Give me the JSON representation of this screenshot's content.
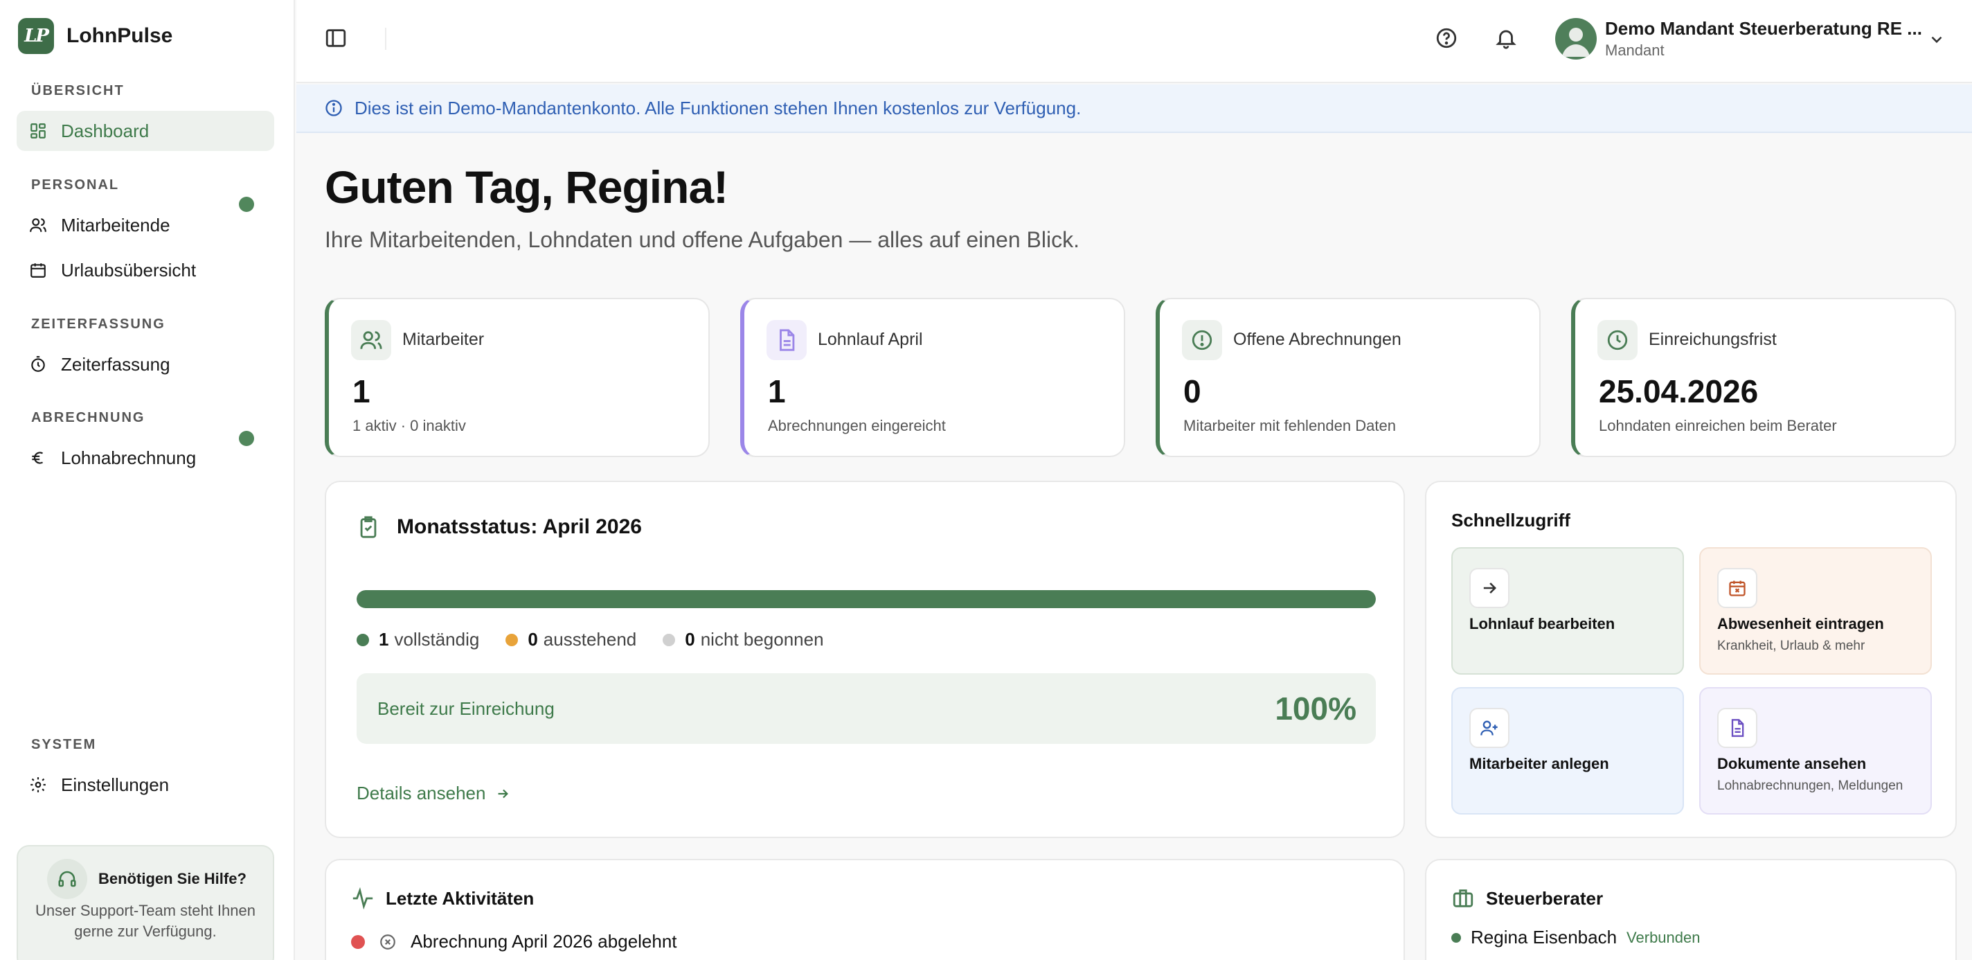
{
  "brand": {
    "logo_text": "LP",
    "name": "LohnPulse"
  },
  "sidebar": {
    "sections": [
      {
        "label": "ÜBERSICHT",
        "items": [
          {
            "label": "Dashboard",
            "icon": "dashboard-icon",
            "active": true
          }
        ]
      },
      {
        "label": "PERSONAL",
        "items": [
          {
            "label": "Mitarbeitende",
            "icon": "users-icon"
          },
          {
            "label": "Urlaubsübersicht",
            "icon": "calendar-icon"
          }
        ]
      },
      {
        "label": "ZEITERFASSUNG",
        "items": [
          {
            "label": "Zeiterfassung",
            "icon": "timer-icon"
          }
        ]
      },
      {
        "label": "ABRECHNUNG",
        "items": [
          {
            "label": "Lohnabrechnung",
            "icon": "euro-icon"
          }
        ]
      },
      {
        "label": "SYSTEM",
        "items": [
          {
            "label": "Einstellungen",
            "icon": "gear-icon"
          }
        ]
      }
    ],
    "help": {
      "title": "Benötigen Sie Hilfe?",
      "text": "Unser Support-Team steht Ihnen gerne zur Verfügung."
    }
  },
  "topbar": {
    "user_name": "Demo Mandant Steuerberatung RE ...",
    "user_role": "Mandant"
  },
  "banner": {
    "text": "Dies ist ein Demo-Mandantenkonto. Alle Funktionen stehen Ihnen kostenlos zur Verfügung."
  },
  "greeting": {
    "title": "Guten Tag, Regina!",
    "subtitle": "Ihre Mitarbeitenden, Lohndaten und offene Aufgaben — alles auf einen Blick."
  },
  "stats": [
    {
      "label": "Mitarbeiter",
      "value": "1",
      "sub": "1 aktiv · 0 inaktiv"
    },
    {
      "label": "Lohnlauf April",
      "value": "1",
      "sub": "Abrechnungen eingereicht"
    },
    {
      "label": "Offene Abrechnungen",
      "value": "0",
      "sub": "Mitarbeiter mit fehlenden Daten"
    },
    {
      "label": "Einreichungsfrist",
      "value": "25.04.2026",
      "sub": "Lohndaten einreichen beim Berater"
    }
  ],
  "month_status": {
    "title": "Monatsstatus: April 2026",
    "progress_fraction": 1.0,
    "legend": [
      {
        "count": "1",
        "label": "vollständig",
        "color": "#4a7d55"
      },
      {
        "count": "0",
        "label": "ausstehend",
        "color": "#e8a33a"
      },
      {
        "count": "0",
        "label": "nicht begonnen",
        "color": "#d0d0d0"
      }
    ],
    "ready_label": "Bereit zur Einreichung",
    "ready_percent": "100%",
    "details_link": "Details ansehen"
  },
  "quick_access": {
    "title": "Schnellzugriff",
    "tiles": [
      {
        "title": "Lohnlauf bearbeiten",
        "sub": "",
        "icon": "arrow-right-icon",
        "bg": "#eef3ee",
        "border": "#d5e1d5",
        "icon_color": "#333333"
      },
      {
        "title": "Abwesenheit eintragen",
        "sub": "Krankheit, Urlaub & mehr",
        "icon": "calendar-x-icon",
        "bg": "#fdf3ec",
        "border": "#f3e1d3",
        "icon_color": "#c0552a"
      },
      {
        "title": "Mitarbeiter anlegen",
        "sub": "",
        "icon": "user-plus-icon",
        "bg": "#eef4fd",
        "border": "#d9e5f6",
        "icon_color": "#2f5fb3"
      },
      {
        "title": "Dokumente ansehen",
        "sub": "Lohnabrechnungen, Meldungen",
        "icon": "document-icon",
        "bg": "#f5f3fd",
        "border": "#e3def5",
        "icon_color": "#6b4fc2"
      }
    ]
  },
  "activities": {
    "title": "Letzte Aktivitäten",
    "items": [
      {
        "text": "Abrechnung April 2026 abgelehnt"
      }
    ]
  },
  "tax_advisor": {
    "title": "Steuerberater",
    "name": "Regina Eisenbach",
    "status": "Verbunden"
  }
}
